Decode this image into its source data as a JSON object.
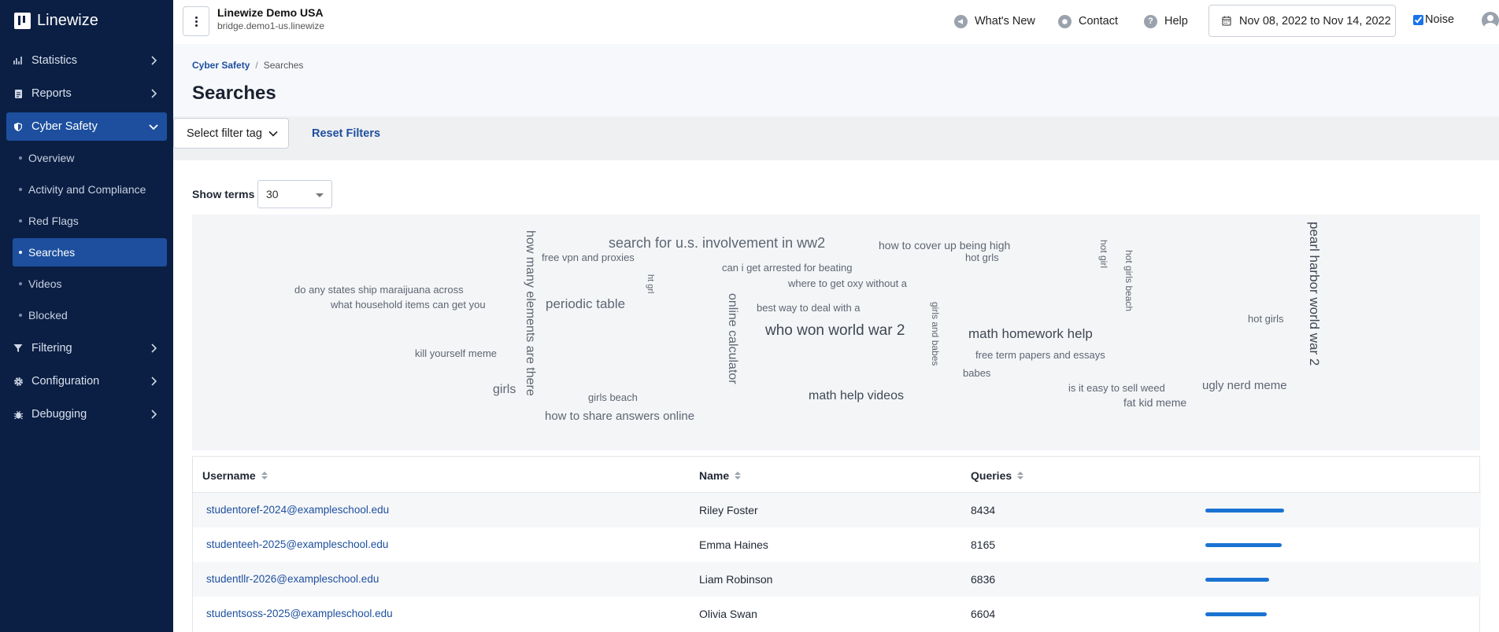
{
  "app": {
    "logo_text": "Linewize"
  },
  "sidebar": {
    "items": [
      {
        "label": "Statistics",
        "icon": "chart-icon"
      },
      {
        "label": "Reports",
        "icon": "document-icon"
      },
      {
        "label": "Cyber Safety",
        "icon": "shield-icon",
        "active": true
      },
      {
        "label": "Filtering",
        "icon": "filter-icon"
      },
      {
        "label": "Configuration",
        "icon": "gear-icon"
      },
      {
        "label": "Debugging",
        "icon": "bug-icon"
      }
    ],
    "sub_items": [
      {
        "label": "Overview"
      },
      {
        "label": "Activity and Compliance"
      },
      {
        "label": "Red Flags"
      },
      {
        "label": "Searches",
        "active": true
      },
      {
        "label": "Videos"
      },
      {
        "label": "Blocked"
      }
    ]
  },
  "header": {
    "org_name": "Linewize Demo USA",
    "org_host": "bridge.demo1-us.linewize",
    "whats_new": "What's New",
    "contact": "Contact",
    "help": "Help",
    "date_range": "Nov 08, 2022 to Nov 14, 2022",
    "noise_label": "Noise",
    "noise_checked": true
  },
  "breadcrumb": {
    "parent": "Cyber Safety",
    "separator": "/",
    "current": "Searches"
  },
  "page_title": "Searches",
  "filters": {
    "tag_label": "Select filter tag",
    "reset_label": "Reset Filters"
  },
  "show_terms": {
    "label": "Show terms",
    "value": "30"
  },
  "word_cloud": [
    {
      "text": "search for u.s. involvement in ww2",
      "weight": 3
    },
    {
      "text": "how to cover up being high",
      "weight": 2
    },
    {
      "text": "free vpn and proxies",
      "weight": 1
    },
    {
      "text": "hot grls",
      "weight": 1
    },
    {
      "text": "can i get arrested for beating",
      "weight": 1
    },
    {
      "text": "where to get oxy without a",
      "weight": 1
    },
    {
      "text": "do any states ship maraijuana across",
      "weight": 1
    },
    {
      "text": "what household items can get you",
      "weight": 1
    },
    {
      "text": "periodic table",
      "weight": 3
    },
    {
      "text": "best way to deal with a",
      "weight": 1
    },
    {
      "text": "who won world war 2",
      "weight": 4
    },
    {
      "text": "math homework help",
      "weight": 3
    },
    {
      "text": "hot girls",
      "weight": 1
    },
    {
      "text": "kill yourself meme",
      "weight": 1
    },
    {
      "text": "free term papers and essays",
      "weight": 1
    },
    {
      "text": "babes",
      "weight": 1
    },
    {
      "text": "girls",
      "weight": 3
    },
    {
      "text": "girls beach",
      "weight": 1
    },
    {
      "text": "math help videos",
      "weight": 3
    },
    {
      "text": "is it easy to sell weed",
      "weight": 1
    },
    {
      "text": "ugly nerd meme",
      "weight": 2
    },
    {
      "text": "fat kid meme",
      "weight": 2
    },
    {
      "text": "how to share answers online",
      "weight": 2
    },
    {
      "text": "how many elements are there",
      "weight": 3
    },
    {
      "text": "ht grl",
      "weight": 1
    },
    {
      "text": "online calculator",
      "weight": 3
    },
    {
      "text": "girls and babes",
      "weight": 1
    },
    {
      "text": "hot girl",
      "weight": 1
    },
    {
      "text": "hot girls beach",
      "weight": 1
    },
    {
      "text": "pearl harbor world war 2",
      "weight": 4
    }
  ],
  "table": {
    "columns": [
      "Username",
      "Name",
      "Queries"
    ],
    "max_queries": 8434,
    "rows": [
      {
        "username": "studentoref-2024@exampleschool.edu",
        "name": "Riley Foster",
        "queries": "8434",
        "queries_value": 8434
      },
      {
        "username": "studenteeh-2025@exampleschool.edu",
        "name": "Emma Haines",
        "queries": "8165",
        "queries_value": 8165
      },
      {
        "username": "studentllr-2026@exampleschool.edu",
        "name": "Liam Robinson",
        "queries": "6836",
        "queries_value": 6836
      },
      {
        "username": "studentsoss-2025@exampleschool.edu",
        "name": "Olivia Swan",
        "queries": "6604",
        "queries_value": 6604
      }
    ]
  }
}
